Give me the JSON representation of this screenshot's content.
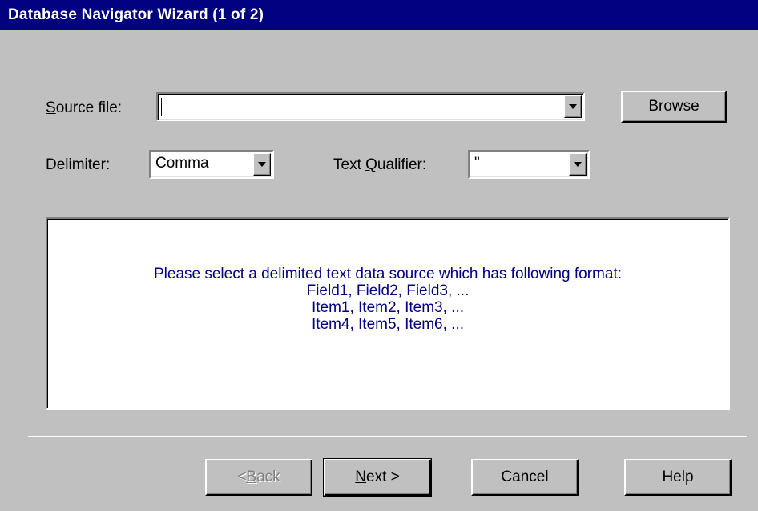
{
  "window": {
    "title": "Database Navigator Wizard (1 of 2)"
  },
  "source": {
    "label_accel": "S",
    "label_rest": "ource file:",
    "value": "",
    "browse_accel": "B",
    "browse_rest": "rowse"
  },
  "delimiter": {
    "label": "Delimiter:",
    "value": "Comma"
  },
  "qualifier": {
    "label_pre": "Text ",
    "label_accel": "Q",
    "label_rest": "ualifier:",
    "value": "\""
  },
  "info": {
    "lines": [
      "Please select a delimited text data source which has following format:",
      "Field1, Field2, Field3, ...",
      "Item1, Item2, Item3, ...",
      "Item4, Item5, Item6, ..."
    ]
  },
  "buttons": {
    "back_pre": "< ",
    "back_accel": "B",
    "back_rest": "ack",
    "next_accel": "N",
    "next_rest": "ext >",
    "cancel": "Cancel",
    "help": "Help"
  }
}
